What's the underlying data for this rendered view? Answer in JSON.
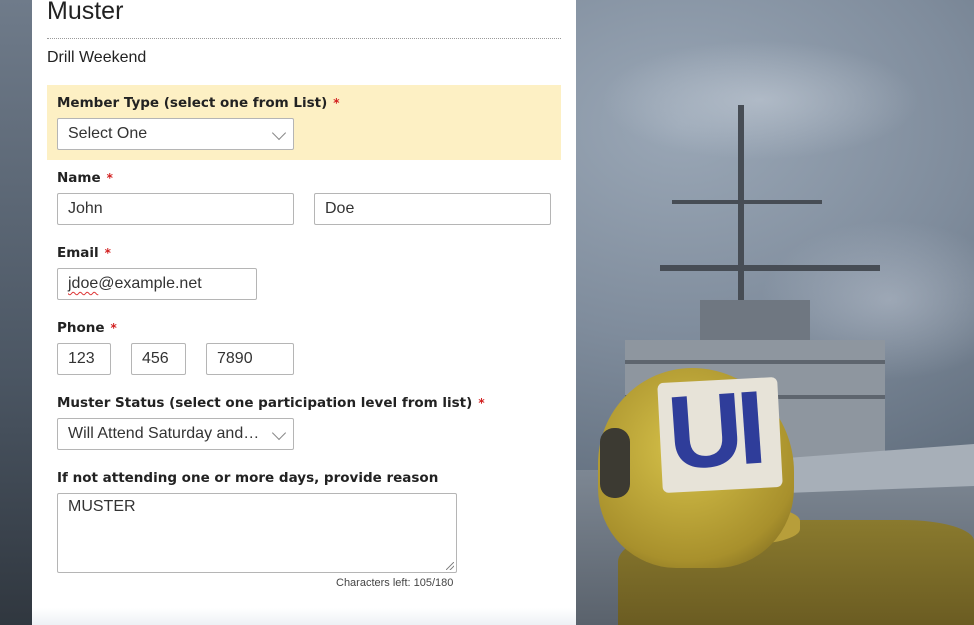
{
  "form": {
    "title": "Muster",
    "subtitle": "Drill Weekend",
    "member_type": {
      "label": "Member Type (select one from List)",
      "required_mark": "*",
      "selected": "Select One"
    },
    "name": {
      "label": "Name",
      "required_mark": "*",
      "first": "John",
      "last": "Doe"
    },
    "email": {
      "label": "Email",
      "required_mark": "*",
      "value_prefix": "jdoe",
      "value_suffix": "@example.net"
    },
    "phone": {
      "label": "Phone",
      "required_mark": "*",
      "area": "123",
      "prefix": "456",
      "line": "7890"
    },
    "muster_status": {
      "label": "Muster Status (select one participation level from list)",
      "required_mark": "*",
      "selected": "Will Attend Saturday and Sunday"
    },
    "reason": {
      "label": "If not attending one or more days, provide reason",
      "value": "MUSTER",
      "chars_left": "Characters left: 105/180"
    }
  },
  "colors": {
    "highlight": "#fdf0c4",
    "required": "#d21f1f",
    "helmet_letters": "#2f3d9a"
  },
  "background": {
    "helmet_text": "UI"
  }
}
